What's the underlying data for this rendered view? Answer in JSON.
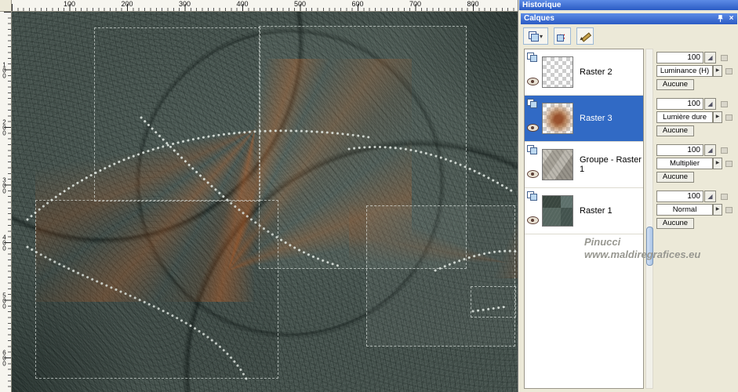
{
  "panels": {
    "historique_title": "Historique",
    "calques_title": "Calques"
  },
  "icons": {
    "dropdown_arrow": "▾",
    "delete_glyph": "×",
    "close_glyph": "×",
    "blend_arrow": "▶",
    "slider_glyph": "◢"
  },
  "ruler": {
    "h_labels": [
      "100",
      "200",
      "300",
      "400",
      "500",
      "600",
      "700",
      "800"
    ],
    "v_labels": [
      "100",
      "200",
      "300",
      "400",
      "500",
      "600"
    ]
  },
  "layers": [
    {
      "name": "Raster 2",
      "opacity": "100",
      "blend": "Luminance (H)",
      "link": "Aucune"
    },
    {
      "name": "Raster 3",
      "opacity": "100",
      "blend": "Lumière dure",
      "link": "Aucune"
    },
    {
      "name": "Groupe - Raster 1",
      "opacity": "100",
      "blend": "Multiplier",
      "link": "Aucune"
    },
    {
      "name": "Raster 1",
      "opacity": "100",
      "blend": "Normal",
      "link": "Aucune"
    }
  ],
  "watermark": {
    "line1": "Pinucci",
    "line2": "www.maldiregrafices.eu"
  },
  "colors": {
    "titlebar_blue": "#2b5bc4",
    "selected_blue": "#316ac5",
    "panel_tan": "#ece9d8"
  }
}
